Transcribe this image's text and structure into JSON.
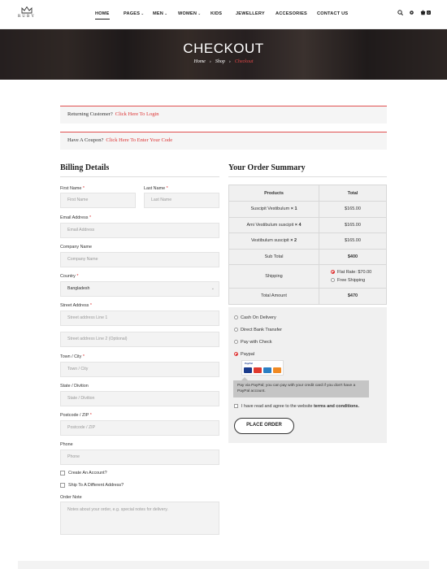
{
  "brand": {
    "name": "RUBY"
  },
  "nav": {
    "items": [
      {
        "label": "HOME",
        "dropdown": false,
        "active": true
      },
      {
        "label": "PAGES",
        "dropdown": true
      },
      {
        "label": "MEN",
        "dropdown": true
      },
      {
        "label": "WOMEN",
        "dropdown": true
      },
      {
        "label": "KIDS",
        "dropdown": false
      },
      {
        "label": "JEWELLERY",
        "dropdown": false
      },
      {
        "label": "ACCESORIES",
        "dropdown": false
      },
      {
        "label": "CONTACT US",
        "dropdown": false
      }
    ],
    "icons": [
      "search-icon",
      "gear-icon",
      "cart-icon"
    ],
    "cart_count": "0"
  },
  "hero": {
    "title": "CHECKOUT",
    "breadcrumb": [
      "Home",
      "Shop",
      "Checkout"
    ]
  },
  "notices": {
    "returning_text": "Returning Customer?",
    "returning_link": "Click Here To Login",
    "coupon_text": "Have A Coupon?",
    "coupon_link": "Click Here To Enter Your Code"
  },
  "billing": {
    "title": "Billing Details",
    "first_name": {
      "label": "First Name",
      "placeholder": "First Name"
    },
    "last_name": {
      "label": "Last Name",
      "placeholder": "Last Name"
    },
    "email": {
      "label": "Email Address",
      "placeholder": "Email Address"
    },
    "company": {
      "label": "Company Name",
      "placeholder": "Company Name"
    },
    "country": {
      "label": "Country",
      "value": "Bangladesh"
    },
    "street": {
      "label": "Street Address",
      "placeholder1": "Street address Line 1",
      "placeholder2": "Street address Line 2 (Optional)"
    },
    "town": {
      "label": "Town / City",
      "placeholder": "Town / City"
    },
    "state": {
      "label": "State / Divition",
      "placeholder": "State / Divition"
    },
    "postcode": {
      "label": "Postcode / ZIP",
      "placeholder": "Postcode / ZIP"
    },
    "phone": {
      "label": "Phone",
      "placeholder": "Phone"
    },
    "create_account": "Create An Account?",
    "ship_different": "Ship To A Different Address?",
    "order_note": {
      "label": "Order Note",
      "placeholder": "Notes about your order, e.g. special notes for delivery."
    }
  },
  "summary": {
    "title": "Your Order Summary",
    "headers": {
      "products": "Products",
      "total": "Total"
    },
    "rows": [
      {
        "name": "Suscipit Vestibulum",
        "qty": "× 1",
        "total": "$165.00"
      },
      {
        "name": "Ami Vestibulum suscipit",
        "qty": "× 4",
        "total": "$165.00"
      },
      {
        "name": "Vestibulum suscipit",
        "qty": "× 2",
        "total": "$165.00"
      }
    ],
    "subtotal": {
      "label": "Sub Total",
      "value": "$400"
    },
    "shipping": {
      "label": "Shipping",
      "options": [
        "Flat Rate: $70.00",
        "Free Shipping"
      ],
      "selected": 0
    },
    "total": {
      "label": "Total Amount",
      "value": "$470"
    }
  },
  "payment": {
    "options": [
      "Cash On Delivery",
      "Direct Bank Transfer",
      "Pay with Check",
      "Paypal"
    ],
    "selected": 3,
    "paypal_note": "Pay via PayPal; you can pay with your credit card if you don't have a PayPal account.",
    "card_logo_text": "PayPal",
    "terms_text": "I have read and agree to the website",
    "terms_link": "terms and conditions.",
    "place_order": "PLACE ORDER"
  },
  "colors": {
    "accent": "#dd3333",
    "dark": "#222222",
    "panel": "#f0f0f0"
  }
}
